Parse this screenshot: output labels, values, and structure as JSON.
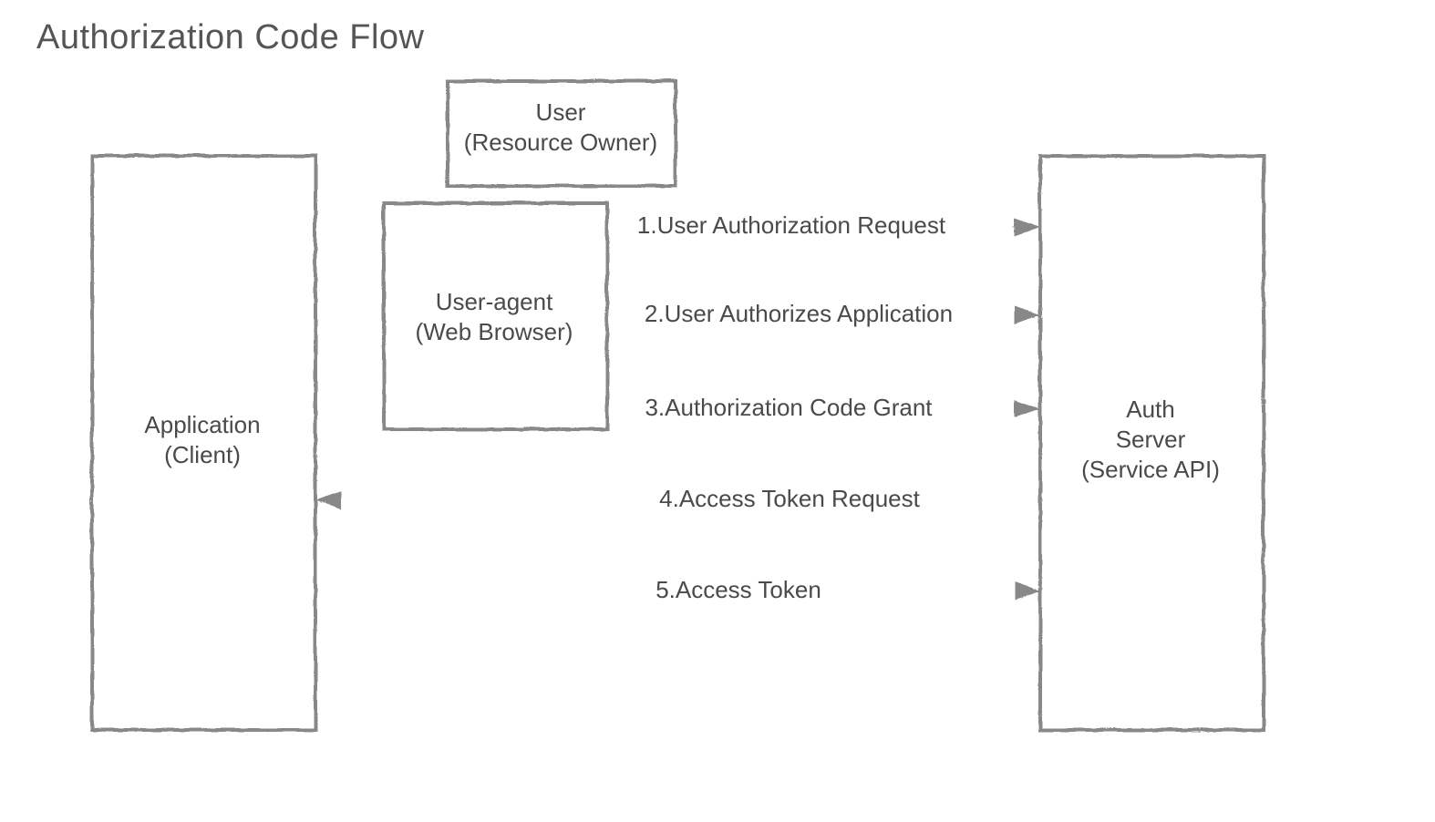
{
  "title": "Authorization Code Flow",
  "boxes": {
    "application": {
      "line1": "Application",
      "line2": "(Client)"
    },
    "user": {
      "line1": "User",
      "line2": "(Resource Owner)"
    },
    "ua": {
      "line1": "User-agent",
      "line2": "(Web Browser)"
    },
    "auth": {
      "line1": "Auth",
      "line2": "Server",
      "line3": "(Service API)"
    }
  },
  "flows": {
    "s1": "1.User Authorization Request",
    "s2": "2.User Authorizes Application",
    "s3": "3.Authorization Code Grant",
    "s4": "4.Access Token Request",
    "s5": "5.Access Token"
  }
}
